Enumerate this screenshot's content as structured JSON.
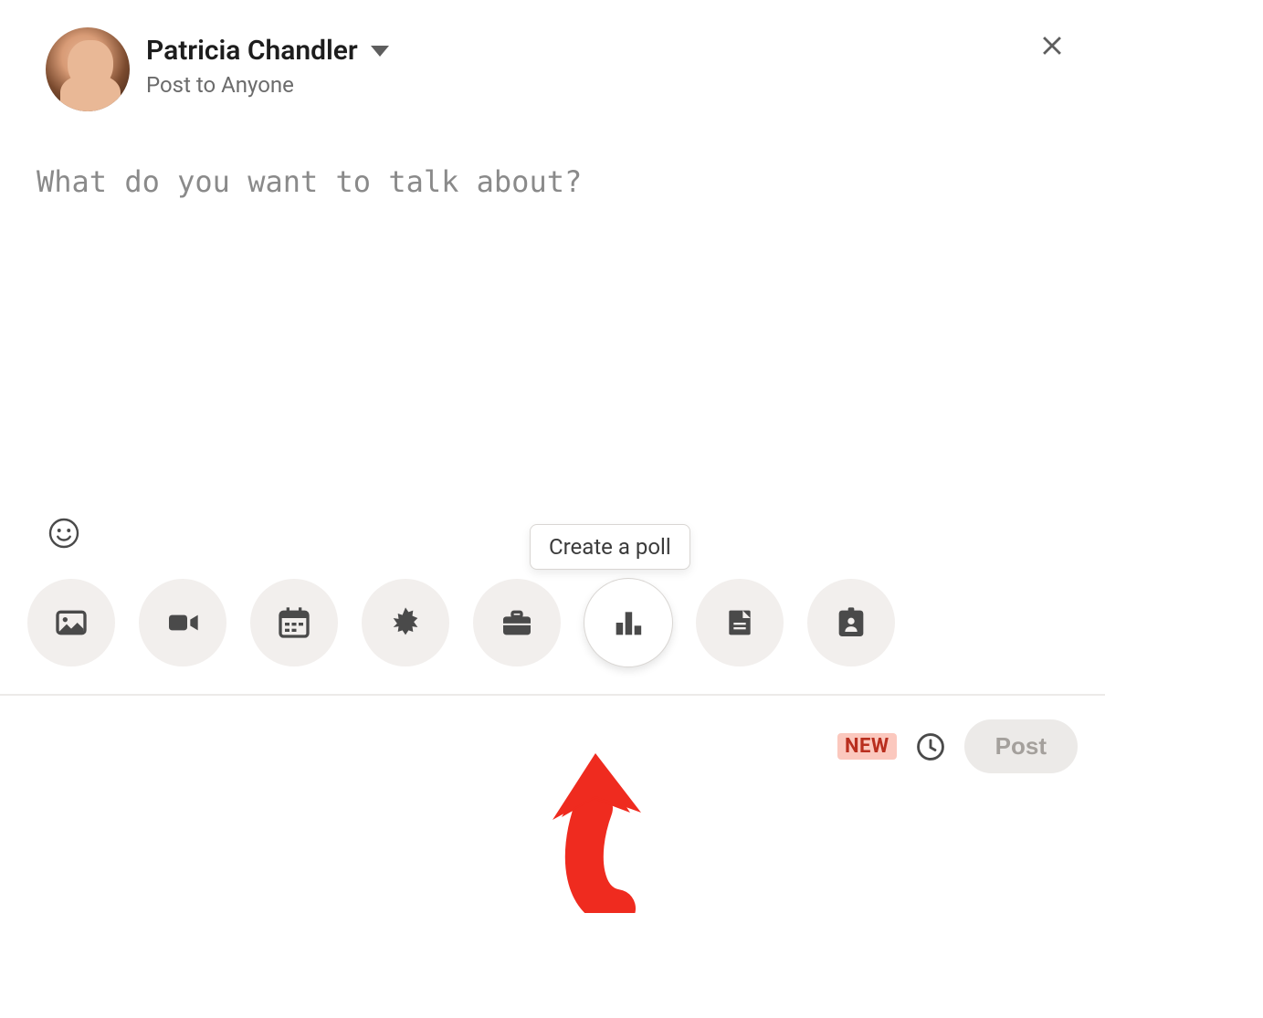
{
  "user": {
    "name": "Patricia Chandler",
    "audience": "Post to Anyone"
  },
  "compose": {
    "placeholder": "What do you want to talk about?"
  },
  "tooltip": {
    "poll": "Create a poll"
  },
  "footer": {
    "new_badge": "NEW",
    "post_label": "Post"
  }
}
